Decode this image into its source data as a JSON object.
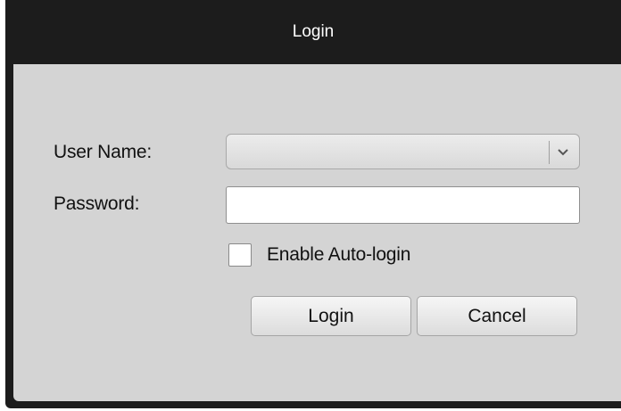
{
  "window": {
    "title": "Login"
  },
  "form": {
    "username_label": "User Name:",
    "username_value": "",
    "password_label": "Password:",
    "password_value": "",
    "auto_login_label": "Enable Auto-login",
    "auto_login_checked": false
  },
  "buttons": {
    "login_label": "Login",
    "cancel_label": "Cancel"
  },
  "icons": {
    "dropdown": "chevron-down-icon"
  },
  "colors": {
    "titlebar": "#1c1c1c",
    "body": "#d4d4d4"
  }
}
